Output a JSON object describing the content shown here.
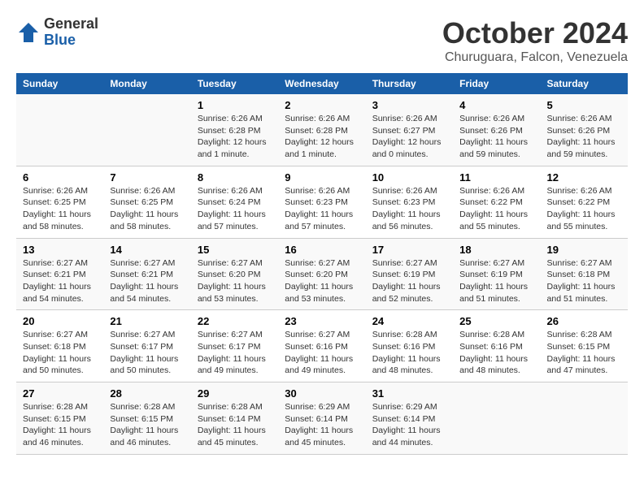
{
  "header": {
    "logo_general": "General",
    "logo_blue": "Blue",
    "month_title": "October 2024",
    "location": "Churuguara, Falcon, Venezuela"
  },
  "weekdays": [
    "Sunday",
    "Monday",
    "Tuesday",
    "Wednesday",
    "Thursday",
    "Friday",
    "Saturday"
  ],
  "weeks": [
    [
      {
        "day": "",
        "info": ""
      },
      {
        "day": "",
        "info": ""
      },
      {
        "day": "1",
        "info": "Sunrise: 6:26 AM\nSunset: 6:28 PM\nDaylight: 12 hours\nand 1 minute."
      },
      {
        "day": "2",
        "info": "Sunrise: 6:26 AM\nSunset: 6:28 PM\nDaylight: 12 hours\nand 1 minute."
      },
      {
        "day": "3",
        "info": "Sunrise: 6:26 AM\nSunset: 6:27 PM\nDaylight: 12 hours\nand 0 minutes."
      },
      {
        "day": "4",
        "info": "Sunrise: 6:26 AM\nSunset: 6:26 PM\nDaylight: 11 hours\nand 59 minutes."
      },
      {
        "day": "5",
        "info": "Sunrise: 6:26 AM\nSunset: 6:26 PM\nDaylight: 11 hours\nand 59 minutes."
      }
    ],
    [
      {
        "day": "6",
        "info": "Sunrise: 6:26 AM\nSunset: 6:25 PM\nDaylight: 11 hours\nand 58 minutes."
      },
      {
        "day": "7",
        "info": "Sunrise: 6:26 AM\nSunset: 6:25 PM\nDaylight: 11 hours\nand 58 minutes."
      },
      {
        "day": "8",
        "info": "Sunrise: 6:26 AM\nSunset: 6:24 PM\nDaylight: 11 hours\nand 57 minutes."
      },
      {
        "day": "9",
        "info": "Sunrise: 6:26 AM\nSunset: 6:23 PM\nDaylight: 11 hours\nand 57 minutes."
      },
      {
        "day": "10",
        "info": "Sunrise: 6:26 AM\nSunset: 6:23 PM\nDaylight: 11 hours\nand 56 minutes."
      },
      {
        "day": "11",
        "info": "Sunrise: 6:26 AM\nSunset: 6:22 PM\nDaylight: 11 hours\nand 55 minutes."
      },
      {
        "day": "12",
        "info": "Sunrise: 6:26 AM\nSunset: 6:22 PM\nDaylight: 11 hours\nand 55 minutes."
      }
    ],
    [
      {
        "day": "13",
        "info": "Sunrise: 6:27 AM\nSunset: 6:21 PM\nDaylight: 11 hours\nand 54 minutes."
      },
      {
        "day": "14",
        "info": "Sunrise: 6:27 AM\nSunset: 6:21 PM\nDaylight: 11 hours\nand 54 minutes."
      },
      {
        "day": "15",
        "info": "Sunrise: 6:27 AM\nSunset: 6:20 PM\nDaylight: 11 hours\nand 53 minutes."
      },
      {
        "day": "16",
        "info": "Sunrise: 6:27 AM\nSunset: 6:20 PM\nDaylight: 11 hours\nand 53 minutes."
      },
      {
        "day": "17",
        "info": "Sunrise: 6:27 AM\nSunset: 6:19 PM\nDaylight: 11 hours\nand 52 minutes."
      },
      {
        "day": "18",
        "info": "Sunrise: 6:27 AM\nSunset: 6:19 PM\nDaylight: 11 hours\nand 51 minutes."
      },
      {
        "day": "19",
        "info": "Sunrise: 6:27 AM\nSunset: 6:18 PM\nDaylight: 11 hours\nand 51 minutes."
      }
    ],
    [
      {
        "day": "20",
        "info": "Sunrise: 6:27 AM\nSunset: 6:18 PM\nDaylight: 11 hours\nand 50 minutes."
      },
      {
        "day": "21",
        "info": "Sunrise: 6:27 AM\nSunset: 6:17 PM\nDaylight: 11 hours\nand 50 minutes."
      },
      {
        "day": "22",
        "info": "Sunrise: 6:27 AM\nSunset: 6:17 PM\nDaylight: 11 hours\nand 49 minutes."
      },
      {
        "day": "23",
        "info": "Sunrise: 6:27 AM\nSunset: 6:16 PM\nDaylight: 11 hours\nand 49 minutes."
      },
      {
        "day": "24",
        "info": "Sunrise: 6:28 AM\nSunset: 6:16 PM\nDaylight: 11 hours\nand 48 minutes."
      },
      {
        "day": "25",
        "info": "Sunrise: 6:28 AM\nSunset: 6:16 PM\nDaylight: 11 hours\nand 48 minutes."
      },
      {
        "day": "26",
        "info": "Sunrise: 6:28 AM\nSunset: 6:15 PM\nDaylight: 11 hours\nand 47 minutes."
      }
    ],
    [
      {
        "day": "27",
        "info": "Sunrise: 6:28 AM\nSunset: 6:15 PM\nDaylight: 11 hours\nand 46 minutes."
      },
      {
        "day": "28",
        "info": "Sunrise: 6:28 AM\nSunset: 6:15 PM\nDaylight: 11 hours\nand 46 minutes."
      },
      {
        "day": "29",
        "info": "Sunrise: 6:28 AM\nSunset: 6:14 PM\nDaylight: 11 hours\nand 45 minutes."
      },
      {
        "day": "30",
        "info": "Sunrise: 6:29 AM\nSunset: 6:14 PM\nDaylight: 11 hours\nand 45 minutes."
      },
      {
        "day": "31",
        "info": "Sunrise: 6:29 AM\nSunset: 6:14 PM\nDaylight: 11 hours\nand 44 minutes."
      },
      {
        "day": "",
        "info": ""
      },
      {
        "day": "",
        "info": ""
      }
    ]
  ]
}
